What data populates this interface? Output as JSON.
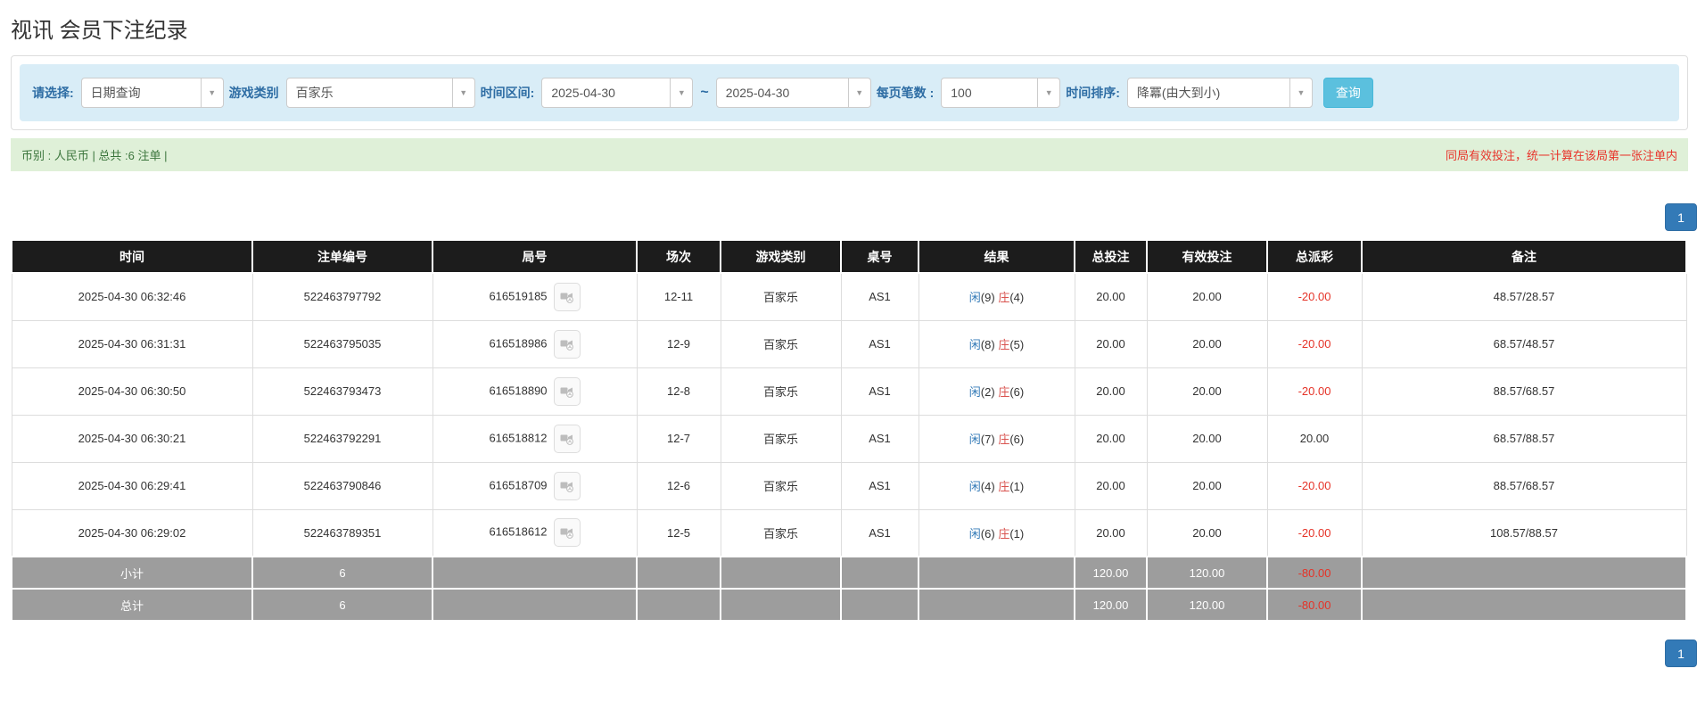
{
  "page": {
    "title": "视讯 会员下注纪录"
  },
  "filters": {
    "select_label": "请选择:",
    "select_value": "日期查询",
    "game_type_label": "游戏类别",
    "game_type_value": "百家乐",
    "date_range_label": "时间区间:",
    "date_from": "2025-04-30",
    "tilde": "~",
    "date_to": "2025-04-30",
    "page_size_label": "每页笔数 :",
    "page_size_value": "100",
    "sort_label": "时间排序:",
    "sort_value": "降冪(由大到小)",
    "search_button": "查询",
    "caret": "▼"
  },
  "summary_bar": {
    "left_text": "币别 : 人民币 | 总共 :6 注单 |",
    "right_text": "同局有效投注，统一计算在该局第一张注单内"
  },
  "pagination": {
    "page": "1"
  },
  "colors": {
    "filter_bg": "#d9edf7",
    "label_blue": "#2e6da4",
    "search_button_blue": "#5bc0de",
    "success_green_bg": "#dff0d8",
    "success_green_text": "#3c763d",
    "notice_red": "#e8332a",
    "header_bg": "#1c1c1c",
    "footer_bg": "#9d9d9d",
    "player_blue": "#337ab7",
    "banker_red": "#d9534f",
    "negative_red": "#e53328",
    "pager_blue": "#337ab7"
  },
  "table": {
    "headers": [
      "时间",
      "注单编号",
      "局号",
      "场次",
      "游戏类别",
      "桌号",
      "结果",
      "总投注",
      "有效投注",
      "总派彩",
      "备注"
    ],
    "rows": [
      {
        "time": "2025-04-30 06:32:46",
        "bet_no": "522463797792",
        "round_no": "616519185",
        "session": "12-11",
        "game": "百家乐",
        "table_no": "AS1",
        "result_player": "闲",
        "result_player_score": "(9)",
        "result_banker": "庄",
        "result_banker_score": "(4)",
        "total_bet": "20.00",
        "valid_bet": "20.00",
        "payout": "-20.00",
        "remark": "48.57/28.57"
      },
      {
        "time": "2025-04-30 06:31:31",
        "bet_no": "522463795035",
        "round_no": "616518986",
        "session": "12-9",
        "game": "百家乐",
        "table_no": "AS1",
        "result_player": "闲",
        "result_player_score": "(8)",
        "result_banker": "庄",
        "result_banker_score": "(5)",
        "total_bet": "20.00",
        "valid_bet": "20.00",
        "payout": "-20.00",
        "remark": "68.57/48.57"
      },
      {
        "time": "2025-04-30 06:30:50",
        "bet_no": "522463793473",
        "round_no": "616518890",
        "session": "12-8",
        "game": "百家乐",
        "table_no": "AS1",
        "result_player": "闲",
        "result_player_score": "(2)",
        "result_banker": "庄",
        "result_banker_score": "(6)",
        "total_bet": "20.00",
        "valid_bet": "20.00",
        "payout": "-20.00",
        "remark": "88.57/68.57"
      },
      {
        "time": "2025-04-30 06:30:21",
        "bet_no": "522463792291",
        "round_no": "616518812",
        "session": "12-7",
        "game": "百家乐",
        "table_no": "AS1",
        "result_player": "闲",
        "result_player_score": "(7)",
        "result_banker": "庄",
        "result_banker_score": "(6)",
        "total_bet": "20.00",
        "valid_bet": "20.00",
        "payout": "20.00",
        "remark": "68.57/88.57"
      },
      {
        "time": "2025-04-30 06:29:41",
        "bet_no": "522463790846",
        "round_no": "616518709",
        "session": "12-6",
        "game": "百家乐",
        "table_no": "AS1",
        "result_player": "闲",
        "result_player_score": "(4)",
        "result_banker": "庄",
        "result_banker_score": "(1)",
        "total_bet": "20.00",
        "valid_bet": "20.00",
        "payout": "-20.00",
        "remark": "88.57/68.57"
      },
      {
        "time": "2025-04-30 06:29:02",
        "bet_no": "522463789351",
        "round_no": "616518612",
        "session": "12-5",
        "game": "百家乐",
        "table_no": "AS1",
        "result_player": "闲",
        "result_player_score": "(6)",
        "result_banker": "庄",
        "result_banker_score": "(1)",
        "total_bet": "20.00",
        "valid_bet": "20.00",
        "payout": "-20.00",
        "remark": "108.57/88.57"
      }
    ],
    "subtotal": {
      "label": "小计",
      "count": "6",
      "total_bet": "120.00",
      "valid_bet": "120.00",
      "payout": "-80.00"
    },
    "total": {
      "label": "总计",
      "count": "6",
      "total_bet": "120.00",
      "valid_bet": "120.00",
      "payout": "-80.00"
    }
  }
}
